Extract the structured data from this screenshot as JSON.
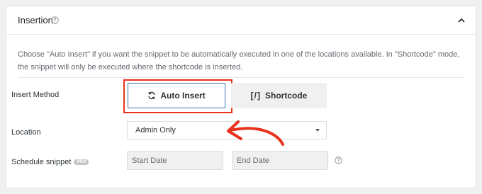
{
  "section": {
    "title": "Insertion",
    "description": "Choose \"Auto Insert\" if you want the snippet to be automatically executed in one of the locations available. In \"Shortcode\" mode, the snippet will only be executed where the shortcode is inserted."
  },
  "insert_method": {
    "label": "Insert Method",
    "auto_insert_label": "Auto Insert",
    "shortcode_mark": "[/]",
    "shortcode_label": "Shortcode",
    "selected": "Auto Insert"
  },
  "location": {
    "label": "Location",
    "value": "Admin Only"
  },
  "schedule": {
    "label": "Schedule snippet",
    "badge": "PRO",
    "start_placeholder": "Start Date",
    "end_placeholder": "End Date"
  },
  "icons": {
    "title_help": "help-circle-icon",
    "collapse": "chevron-up-icon",
    "auto_insert": "refresh-icon",
    "select_caret": "caret-down-icon",
    "date_help": "help-circle-icon",
    "annotation": "red-arrow"
  },
  "colors": {
    "annotation_red": "#e8321e",
    "selected_border": "#3a6fb0",
    "pro_badge": "#c3c4c7"
  }
}
